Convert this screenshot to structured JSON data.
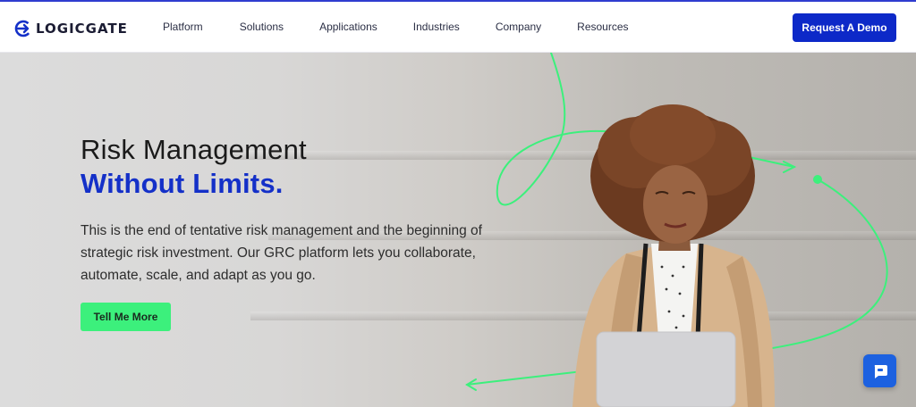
{
  "header": {
    "brand": "LOGICGATE",
    "nav": [
      {
        "label": "Platform"
      },
      {
        "label": "Solutions"
      },
      {
        "label": "Applications"
      },
      {
        "label": "Industries"
      },
      {
        "label": "Company"
      },
      {
        "label": "Resources"
      }
    ],
    "cta_label": "Request A Demo"
  },
  "hero": {
    "title_line1": "Risk Management",
    "title_line2": "Without Limits.",
    "description": "This is the end of tentative risk management and the beginning of strategic risk investment. Our GRC platform lets you collaborate, automate, scale, and adapt as you go.",
    "cta_label": "Tell Me More"
  },
  "colors": {
    "brand_blue": "#0d29c8",
    "accent_green": "#3cf07c",
    "chat_blue": "#1c61e0"
  },
  "icons": [
    "logicgate-logo-icon",
    "chat-icon"
  ]
}
